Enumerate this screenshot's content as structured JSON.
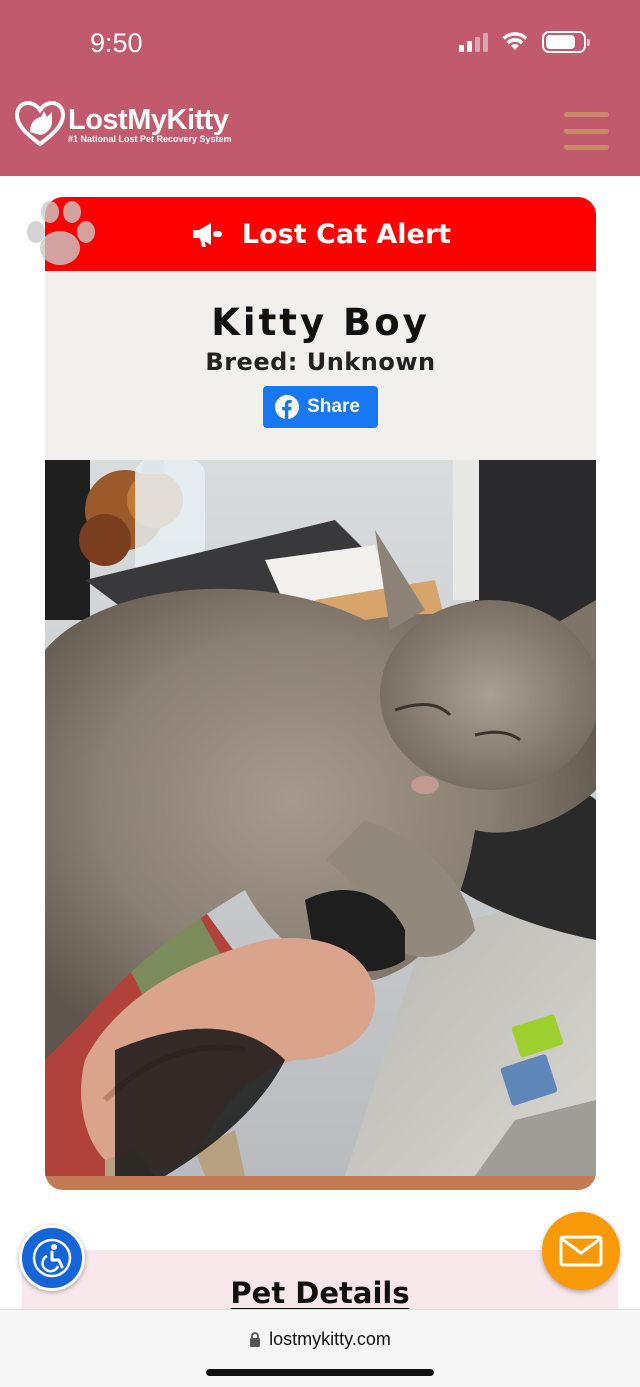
{
  "status_bar": {
    "time": "9:50"
  },
  "header": {
    "logo_name": "LostMyKitty",
    "logo_tagline": "#1 National Lost Pet Recovery System"
  },
  "alert": {
    "title": "Lost Cat Alert"
  },
  "pet": {
    "name": "Kitty Boy",
    "breed": "Breed: Unknown",
    "share_label": "Share"
  },
  "photo": {
    "alt": "grey cat sleeping on desk beside a hand and laptop"
  },
  "details": {
    "title": "Pet Details"
  },
  "browser": {
    "url": "lostmykitty.com"
  },
  "colors": {
    "header": "#c25a6e",
    "alert": "#fe0000",
    "facebook": "#1877f2",
    "accessibility": "#1565d8",
    "mail": "#f89a07"
  }
}
